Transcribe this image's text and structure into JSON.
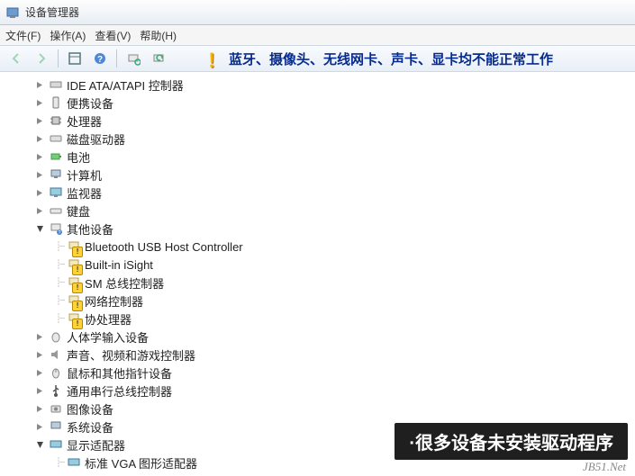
{
  "window": {
    "title": "设备管理器"
  },
  "menu": {
    "file": "文件(F)",
    "action": "操作(A)",
    "view": "查看(V)",
    "help": "帮助(H)"
  },
  "banner": {
    "text": "蓝牙、摄像头、无线网卡、声卡、显卡均不能正常工作"
  },
  "tree": {
    "ide": "IDE ATA/ATAPI 控制器",
    "portable": "便携设备",
    "cpu": "处理器",
    "disk": "磁盘驱动器",
    "battery": "电池",
    "computer": "计算机",
    "monitor": "监视器",
    "keyboard": "键盘",
    "other": "其他设备",
    "bt": "Bluetooth USB Host Controller",
    "isight": "Built-in iSight",
    "sm": "SM 总线控制器",
    "net": "网络控制器",
    "coproc": "协处理器",
    "hid": "人体学输入设备",
    "sound": "声音、视频和游戏控制器",
    "mouse": "鼠标和其他指针设备",
    "usb": "通用串行总线控制器",
    "imaging": "图像设备",
    "system": "系统设备",
    "display": "显示适配器",
    "vga": "标准 VGA 图形适配器"
  },
  "caption": "·很多设备未安装驱动程序",
  "watermark": "JB51.Net"
}
